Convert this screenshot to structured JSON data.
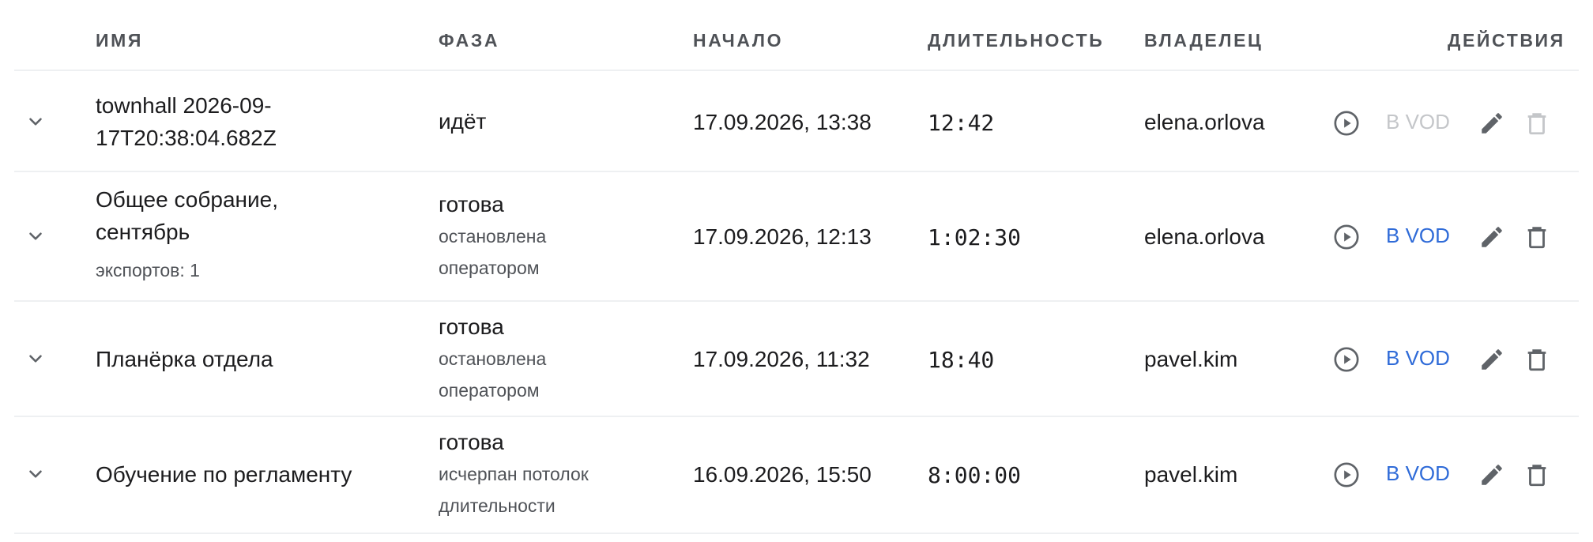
{
  "columns": {
    "name": "ИМЯ",
    "phase": "ФАЗА",
    "start": "НАЧАЛО",
    "duration": "ДЛИТЕЛЬНОСТЬ",
    "owner": "ВЛАДЕЛЕЦ",
    "actions": "ДЕЙСТВИЯ"
  },
  "rows": [
    {
      "name_line1": "townhall 2026-09-",
      "name_line2": "17T20:38:04.682Z",
      "phase": "идёт",
      "start": "17.09.2026, 13:38",
      "duration": "12:42",
      "owner": "elena.orlova",
      "vod_label": "В VOD",
      "vod_enabled": false,
      "delete_enabled": false
    },
    {
      "name_line1": "Общее собрание,",
      "name_line2": "сентябрь",
      "exports": "экспортов: 1",
      "phase": "готова",
      "reason_line1": "остановлена",
      "reason_line2": "оператором",
      "start": "17.09.2026, 12:13",
      "duration": "1:02:30",
      "owner": "elena.orlova",
      "vod_label": "В VOD",
      "vod_enabled": true,
      "delete_enabled": true
    },
    {
      "name_line1": "Планёрка отдела",
      "phase": "готова",
      "reason_line1": "остановлена",
      "reason_line2": "оператором",
      "start": "17.09.2026, 11:32",
      "duration": "18:40",
      "owner": "pavel.kim",
      "vod_label": "В VOD",
      "vod_enabled": true,
      "delete_enabled": true
    },
    {
      "name_line1": "Обучение по регламенту",
      "phase": "готова",
      "reason_line1": "исчерпан потолок",
      "reason_line2": "длительности",
      "start": "16.09.2026, 15:50",
      "duration": "8:00:00",
      "owner": "pavel.kim",
      "vod_label": "В VOD",
      "vod_enabled": true,
      "delete_enabled": true
    }
  ],
  "icons": {
    "expand": "chevron-down-icon",
    "play": "play-circle-icon",
    "edit": "pencil-icon",
    "delete": "trash-icon"
  },
  "colors": {
    "link": "#2f6bd8",
    "disabled": "#c4c6c9",
    "icon": "#5f6368",
    "header_text": "#4f5257"
  }
}
